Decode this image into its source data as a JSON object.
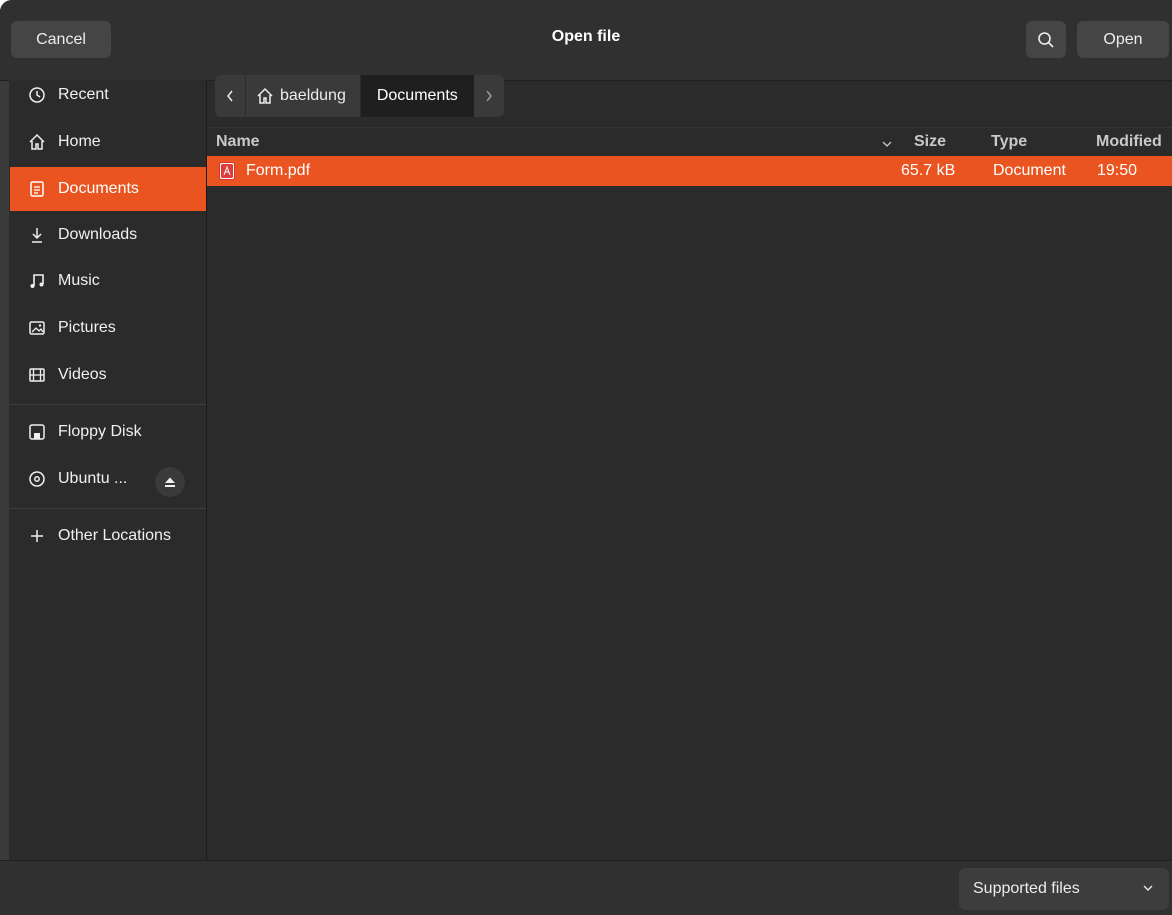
{
  "header": {
    "cancel_label": "Cancel",
    "title": "Open file",
    "search_icon": "search-icon",
    "open_label": "Open"
  },
  "sidebar": {
    "items": [
      {
        "label": "Recent",
        "icon": "clock-icon"
      },
      {
        "label": "Home",
        "icon": "home-icon"
      },
      {
        "label": "Documents",
        "icon": "document-icon",
        "active": true
      },
      {
        "label": "Downloads",
        "icon": "download-icon"
      },
      {
        "label": "Music",
        "icon": "music-icon"
      },
      {
        "label": "Pictures",
        "icon": "picture-icon"
      },
      {
        "label": "Videos",
        "icon": "film-icon"
      }
    ],
    "devices": [
      {
        "label": "Floppy Disk",
        "icon": "floppy-icon"
      },
      {
        "label": "Ubuntu ...",
        "icon": "disc-icon",
        "eject": true
      }
    ],
    "other": {
      "label": "Other Locations",
      "icon": "plus-icon"
    }
  },
  "pathbar": {
    "home_label": "baeldung",
    "current_label": "Documents"
  },
  "columns": {
    "name": "Name",
    "size": "Size",
    "type": "Type",
    "modified": "Modified"
  },
  "files": [
    {
      "name": "Form.pdf",
      "size": "65.7 kB",
      "type": "Document",
      "modified": "19:50",
      "selected": true
    }
  ],
  "footer": {
    "filter_label": "Supported files"
  },
  "colors": {
    "accent": "#e95420",
    "background": "#2b2b2b",
    "header": "#303030"
  }
}
